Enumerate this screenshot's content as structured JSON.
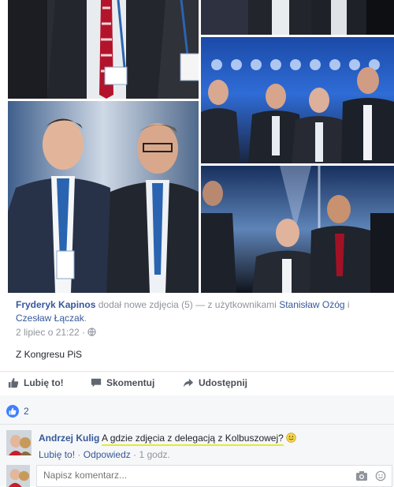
{
  "post": {
    "author": "Fryderyk Kapinos",
    "verb": "dodał nowe zdjęcia (5)",
    "with_prefix": "— z użytkownikami",
    "tagged_1": "Stanisław Ożóg",
    "conj": "i",
    "tagged_2": "Czesław Łączak",
    "tagged_suffix": ".",
    "date": "2 lipiec o 21:22 ·",
    "text": "Z Kongresu PiS"
  },
  "actions": {
    "like": "Lubię to!",
    "comment": "Skomentuj",
    "share": "Udostępnij"
  },
  "likes": {
    "count": "2"
  },
  "comment": {
    "author": "Andrzej Kulig",
    "text": "A gdzie zdjęcia z delegacją z Kolbuszowej?",
    "like": "Lubię to!",
    "sep1": "·",
    "reply": "Odpowiedz",
    "sep2": "·",
    "time": "1 godz."
  },
  "composer": {
    "placeholder": "Napisz komentarz..."
  },
  "colors": {
    "link": "#365899",
    "meta": "#90949c",
    "accent": "#4080ff",
    "highlight": "#e6ec26"
  }
}
